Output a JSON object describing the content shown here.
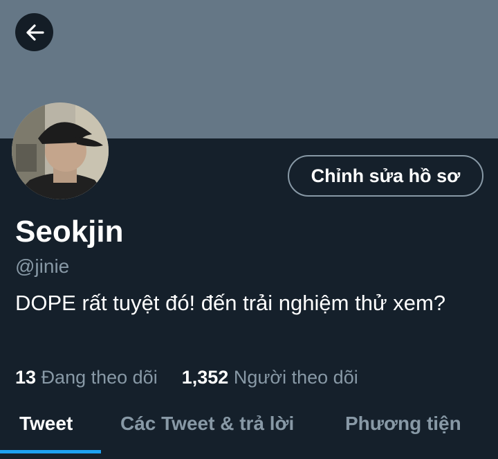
{
  "profile": {
    "display_name": "Seokjin",
    "handle": "@jinie",
    "bio": "DOPE rất tuyệt đó! đến trải nghiệm thử xem?"
  },
  "actions": {
    "edit_profile_label": "Chỉnh sửa hồ sơ",
    "back_icon": "arrow-left-icon"
  },
  "stats": {
    "following_count": "13",
    "following_label": "Đang theo dõi",
    "followers_count": "1,352",
    "followers_label": "Người theo dõi"
  },
  "tabs": [
    {
      "label": "Tweet",
      "active": true
    },
    {
      "label": "Các Tweet & trả lời",
      "active": false
    },
    {
      "label": "Phương tiện",
      "active": false
    }
  ],
  "colors": {
    "background": "#15202b",
    "banner": "#657786",
    "secondary_text": "#8899a6",
    "accent": "#1da1f2"
  }
}
